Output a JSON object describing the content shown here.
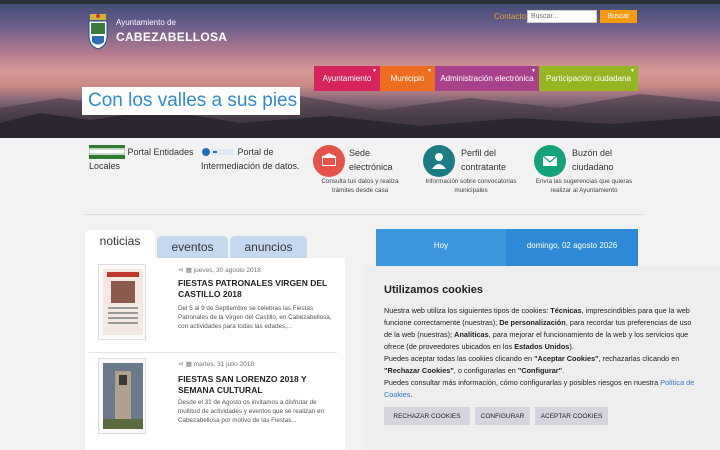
{
  "header": {
    "municipality_prefix": "Ayuntamiento de",
    "municipality_name": "CABEZABELLOSA",
    "contact_link": "Contacto",
    "search_placeholder": "Buscar...",
    "search_button": "Buscar"
  },
  "nav": [
    {
      "label": "Ayuntamiento",
      "color": "#d6245d"
    },
    {
      "label": "Municipio",
      "color": "#ee6d1e"
    },
    {
      "label": "Administración electrónica",
      "color": "#a8408b"
    },
    {
      "label": "Participación ciudadana",
      "color": "#96b522"
    }
  ],
  "slogan": "Con los valles a sus pies",
  "services": {
    "s1_title": "Portal Entidades Locales",
    "s2_title": "Portal de Intermediación de datos.",
    "s3_title": "Sede electrónica",
    "s3_desc": "Consulta tus datos y realiza trámites desde casa",
    "s4_title": "Perfil del contratante",
    "s4_desc": "Información sobre convocatorias municipales",
    "s5_title": "Buzón del ciudadano",
    "s5_desc": "Envía las sugerencias que quieras realizar al Ayuntamiento"
  },
  "tabs": {
    "news": "noticias",
    "events": "eventos",
    "ads": "anuncios"
  },
  "news": [
    {
      "date": "jueves, 30 agosto 2018",
      "title": "FIESTAS PATRONALES VIRGEN DEL CASTILLO 2018",
      "text": "Del 5 al 9 de Septiembre se celebras las Fiestas Patronales de la Virgen del Castillo, en Cabezabellosa, con actividades para todas las edades,..."
    },
    {
      "date": "martes, 31 julio 2018",
      "title": "FIESTAS SAN LORENZO 2018 Y SEMANA CULTURAL",
      "text": "Desde el 31 de Agosto os invitamos a disfrutar de multitud de actividades y eventos que se realizan en Cabezabellosa por motivo de las Fiestas..."
    }
  ],
  "calendar": {
    "today_label": "Hoy",
    "date_label": "domingo, 02 agosto 2026"
  },
  "cookie": {
    "title": "Utilizamos cookies",
    "btn_reject": "RECHAZAR COOKIES",
    "btn_config": "CONFIGURAR",
    "btn_accept": "ACEPTAR COOKIES"
  }
}
